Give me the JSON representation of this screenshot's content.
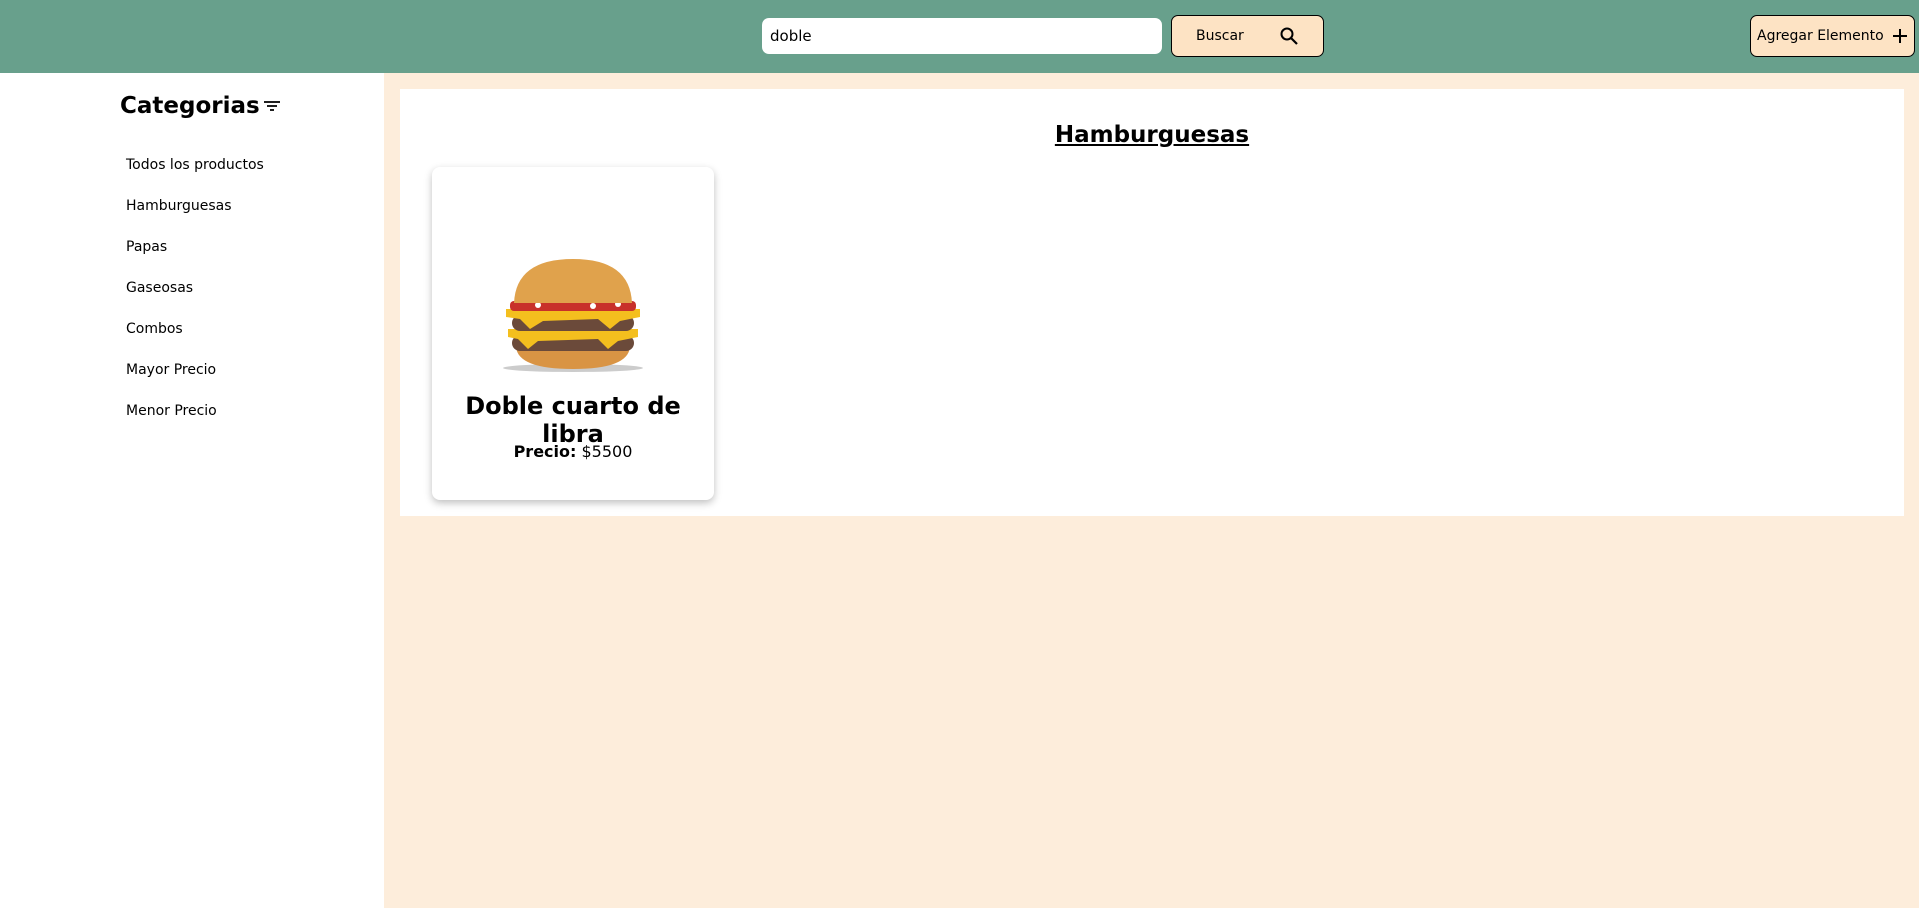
{
  "header": {
    "search_value": "doble",
    "search_button": "Buscar",
    "add_button": "Agregar Elemento"
  },
  "sidebar": {
    "title": "Categorias",
    "items": [
      "Todos los productos",
      "Hamburguesas",
      "Papas",
      "Gaseosas",
      "Combos",
      "Mayor Precio",
      "Menor Precio"
    ]
  },
  "main": {
    "section_title": "Hamburguesas",
    "products": [
      {
        "name": "Doble cuarto de libra",
        "price_label": "Precio:",
        "price": "$5500"
      }
    ]
  },
  "colors": {
    "header": "#68a08c",
    "button": "#fde3c4",
    "background": "#fdeddb"
  }
}
